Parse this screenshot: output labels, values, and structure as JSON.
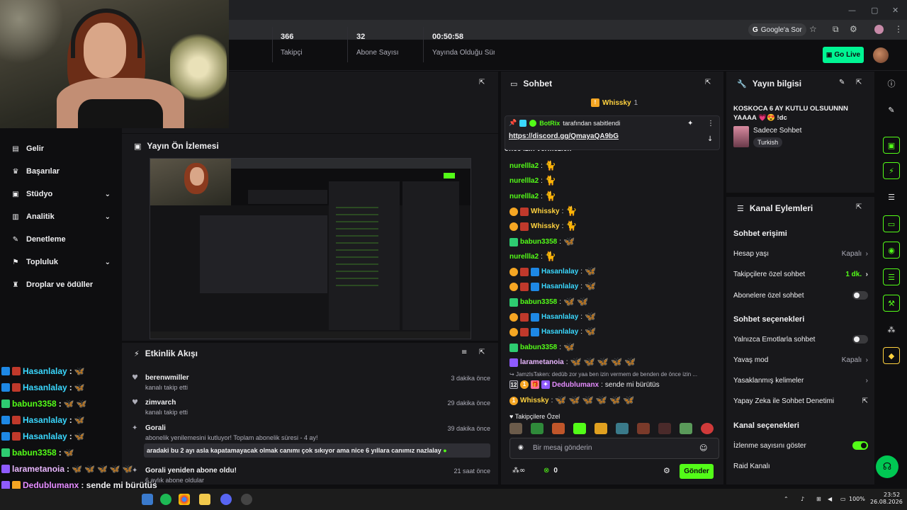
{
  "browser": {
    "google_sor": "Google'a Sor",
    "min": "—",
    "max": "▢",
    "close": "✕"
  },
  "appbar": {
    "go_live": "Go Live"
  },
  "nav": [
    {
      "label": "Gelir",
      "icon": "▤"
    },
    {
      "label": "Başarılar",
      "icon": "♛"
    },
    {
      "label": "Stüdyo",
      "icon": "▣",
      "chevron": true
    },
    {
      "label": "Analitik",
      "icon": "▥",
      "chevron": true
    },
    {
      "label": "Denetleme",
      "icon": "✎"
    },
    {
      "label": "Topluluk",
      "icon": "⚑",
      "chevron": true
    },
    {
      "label": "Droplar ve ödüller",
      "icon": "♜"
    }
  ],
  "stats": [
    {
      "value": "366",
      "label": "Takipçi"
    },
    {
      "value": "32",
      "label": "Abone Sayısı"
    },
    {
      "value": "00:50:58",
      "label": "Yayında Olduğu Süre"
    }
  ],
  "preview": {
    "title": "Yayın Ön İzlemesi"
  },
  "activity": {
    "title": "Etkinlik Akışı",
    "items": [
      {
        "name": "berenwmiller",
        "sub": "kanalı takip etti",
        "time": "3 dakika önce",
        "icon": "♥"
      },
      {
        "name": "zimvarch",
        "sub": "kanalı takip etti",
        "time": "29 dakika önce",
        "icon": "♥"
      },
      {
        "name": "Gorali",
        "sub": "abonelik yenilemesini kutluyor! Toplam abonelik süresi - 4 ay!",
        "time": "39 dakika önce",
        "icon": "✦"
      },
      {
        "name": "Gorali yeniden abone oldu!",
        "sub": "6 aylık abone oldular",
        "time": "21 saat önce",
        "icon": "✦"
      }
    ],
    "message": "aradaki bu 2 ayı asla kapatamayacak olmak canımı çok sıkıyor ama nice 6 yıllara canımız nazlalay"
  },
  "overlay_chat": [
    {
      "user": "Hasanlalay",
      "color": "#3ad8ff",
      "text": ":",
      "emotes": 1
    },
    {
      "user": "Hasanlalay",
      "color": "#3ad8ff",
      "text": ":",
      "emotes": 1
    },
    {
      "user": "babun3358",
      "color": "#53fc18",
      "text": ":",
      "emotes": 2
    },
    {
      "user": "Hasanlalay",
      "color": "#3ad8ff",
      "text": ":",
      "emotes": 1
    },
    {
      "user": "Hasanlalay",
      "color": "#3ad8ff",
      "text": ":",
      "emotes": 1
    },
    {
      "user": "babun3358",
      "color": "#53fc18",
      "text": ":",
      "emotes": 1
    },
    {
      "user": "larametanoia",
      "color": "#e9b7ff",
      "text": ":",
      "emotes": 5
    },
    {
      "user": "Dedublumanx",
      "color": "#e58cff",
      "text": ": sende mi bürütüs",
      "emotes": 0
    },
    {
      "user": "Whissky",
      "color": "#ffd23f",
      "text": ":",
      "emotes": 6
    }
  ],
  "chat": {
    "title": "Sohbet",
    "top_gifter": "Whissky",
    "top_gifter_count": "1",
    "pinned_by": "BotRix",
    "pinned_suffix": "tarafından sabitlendi",
    "pinned_link": "https://discord.gg/QmayaQA9bG",
    "cut_line": "önce izin vermezlen",
    "messages": [
      {
        "user": "nurellla2",
        "color": "#53fc18",
        "emotes": 1
      },
      {
        "user": "nurellla2",
        "color": "#53fc18",
        "emotes": 1
      },
      {
        "user": "nurellla2",
        "color": "#53fc18",
        "emotes": 1
      },
      {
        "user": "Whissky",
        "color": "#ffd23f",
        "emotes": 1
      },
      {
        "user": "Whissky",
        "color": "#ffd23f",
        "emotes": 1
      },
      {
        "user": "babun3358",
        "color": "#53fc18",
        "emotes": 1
      },
      {
        "user": "nurellla2",
        "color": "#53fc18",
        "emotes": 1
      },
      {
        "user": "Hasanlalay",
        "color": "#3ad8ff",
        "emotes": 1
      },
      {
        "user": "Hasanlalay",
        "color": "#3ad8ff",
        "emotes": 1
      },
      {
        "user": "babun3358",
        "color": "#53fc18",
        "emotes": 2
      },
      {
        "user": "Hasanlalay",
        "color": "#3ad8ff",
        "emotes": 1
      },
      {
        "user": "Hasanlalay",
        "color": "#3ad8ff",
        "emotes": 1
      },
      {
        "user": "babun3358",
        "color": "#53fc18",
        "emotes": 1
      },
      {
        "user": "larametanoia",
        "color": "#e9b7ff",
        "emotes": 5
      }
    ],
    "reply_to": "JamzlsTaken: dedüb zor yaa ben izin vermem de benden de önce izin ...",
    "reply_user": "Dedublumanx",
    "reply_text": "sende mi bürütüs",
    "last_user": "Whissky",
    "follower_only": "Takipçilere Özel",
    "input_placeholder": "Bir mesaj gönderin",
    "count": "0",
    "send": "Gönder"
  },
  "stream_info": {
    "title": "Yayın bilgisi",
    "stream_title": "KOSKOCA 6 AY KUTLU OLSUUNNN YAAAA 💗😍 !dc",
    "category": "Sadece Sohbet",
    "language": "Turkish"
  },
  "channel_actions": {
    "title": "Kanal Eylemleri",
    "chat_access": "Sohbet erişimi",
    "account_age": "Hesap yaşı",
    "account_age_val": "Kapalı",
    "follower_chat": "Takipçilere özel sohbet",
    "follower_chat_val": "1 dk.",
    "sub_chat": "Abonelere özel sohbet",
    "chat_options": "Sohbet seçenekleri",
    "emote_only": "Yalnızca Emotlarla sohbet",
    "slow_mode": "Yavaş mod",
    "slow_mode_val": "Kapalı",
    "banned_words": "Yasaklanmış kelimeler",
    "ai_mod": "Yapay Zeka ile Sohbet Denetimi",
    "channel_options": "Kanal seçenekleri",
    "show_viewers": "İzlenme sayısını göster",
    "raid": "Raid Kanalı"
  },
  "taskbar": {
    "battery": "100%",
    "time": "23:52",
    "date": "26.08.2026"
  },
  "colors": {
    "accent": "#53fc18",
    "panel": "#18181b",
    "bg": "#0e0e10"
  }
}
